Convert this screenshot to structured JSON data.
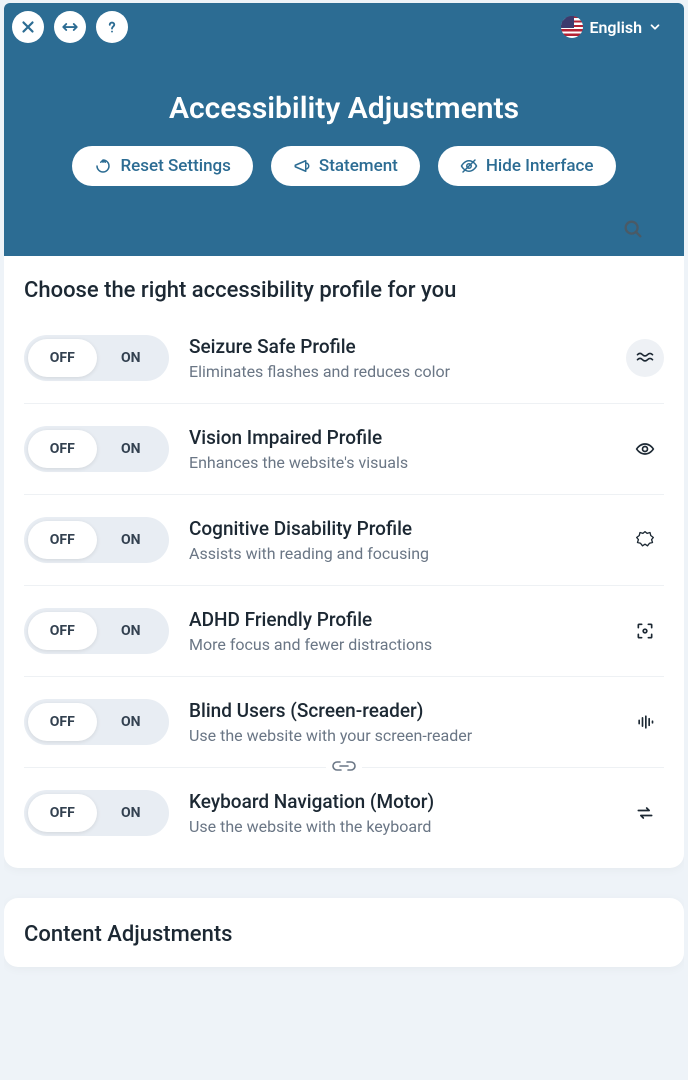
{
  "header": {
    "language": "English",
    "title": "Accessibility Adjustments",
    "buttons": {
      "reset": "Reset Settings",
      "statement": "Statement",
      "hide": "Hide Interface"
    }
  },
  "toggle": {
    "off": "OFF",
    "on": "ON"
  },
  "profilesSection": {
    "title": "Choose the right accessibility profile for you",
    "items": [
      {
        "name": "Seizure Safe Profile",
        "desc": "Eliminates flashes and reduces color",
        "state": "off"
      },
      {
        "name": "Vision Impaired Profile",
        "desc": "Enhances the website's visuals",
        "state": "off"
      },
      {
        "name": "Cognitive Disability Profile",
        "desc": "Assists with reading and focusing",
        "state": "off"
      },
      {
        "name": "ADHD Friendly Profile",
        "desc": "More focus and fewer distractions",
        "state": "off"
      },
      {
        "name": "Blind Users (Screen-reader)",
        "desc": "Use the website with your screen-reader",
        "state": "off"
      },
      {
        "name": "Keyboard Navigation (Motor)",
        "desc": "Use the website with the keyboard",
        "state": "off"
      }
    ]
  },
  "contentSection": {
    "title": "Content Adjustments"
  }
}
